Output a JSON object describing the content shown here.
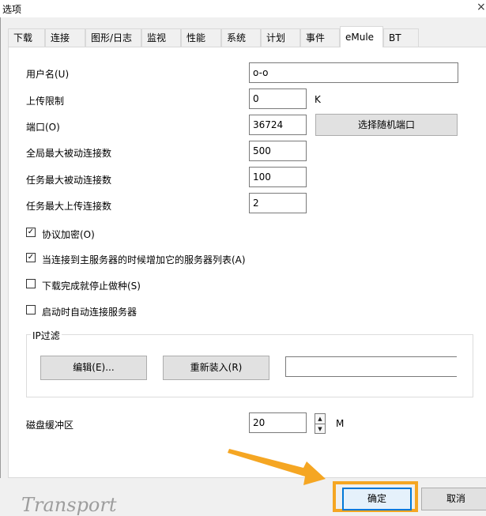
{
  "window": {
    "title": "选项",
    "close_glyph": "×"
  },
  "tabs": [
    "下载",
    "连接",
    "图形/日志",
    "监视",
    "性能",
    "系统",
    "计划",
    "事件",
    "eMule",
    "BT"
  ],
  "active_tab": "eMule",
  "fields": {
    "username": {
      "label": "用户名(U)",
      "value": "o-o"
    },
    "upload_limit": {
      "label": "上传限制",
      "value": "0",
      "unit": "K"
    },
    "port": {
      "label": "端口(O)",
      "value": "36724",
      "button": "选择随机端口"
    },
    "global_max_passive": {
      "label": "全局最大被动连接数",
      "value": "500"
    },
    "task_max_passive": {
      "label": "任务最大被动连接数",
      "value": "100"
    },
    "task_max_upload": {
      "label": "任务最大上传连接数",
      "value": "2"
    }
  },
  "checkboxes": [
    {
      "label": "协议加密(O)",
      "checked": true
    },
    {
      "label": "当连接到主服务器的时候增加它的服务器列表(A)",
      "checked": true
    },
    {
      "label": "下载完成就停止做种(S)",
      "checked": false
    },
    {
      "label": "启动时自动连接服务器",
      "checked": false
    }
  ],
  "check_glyph": "✓",
  "ip_filter": {
    "title": "IP过滤",
    "edit_button": "编辑(E)...",
    "reload_button": "重新装入(R)",
    "path_value": ""
  },
  "disk_cache": {
    "label": "磁盘缓冲区",
    "value": "20",
    "unit": "M",
    "up_glyph": "▲",
    "down_glyph": "▼"
  },
  "footer": {
    "watermark": "Transport",
    "ok_button": "确定",
    "cancel_button": "取消"
  },
  "colors": {
    "highlight": "#f5a623",
    "focus": "#0078d7"
  }
}
